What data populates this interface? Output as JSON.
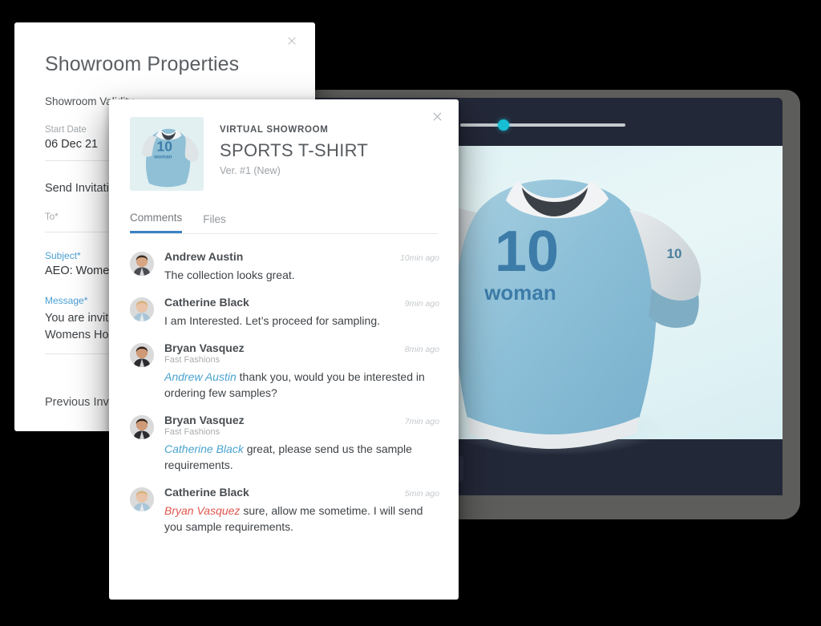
{
  "device": {
    "name": "tablet-device",
    "slider": {
      "name": "zoom-slider",
      "value_pct": 26
    },
    "action_bar": {
      "like_icon": "heart-icon",
      "comment_icon": "chat-bubble-icon",
      "next_icon": "chevron-right-icon"
    },
    "product_preview": {
      "number_print": "10",
      "word_print": "woman",
      "sleeve_print": "10"
    }
  },
  "properties_panel": {
    "close_icon": "close-icon",
    "title": "Showroom Properties",
    "section_validity": "Showroom Validity",
    "start_date": {
      "label": "Start Date",
      "value": "06 Dec 21"
    },
    "send_invitation": "Send Invitation",
    "to": {
      "label": "To*",
      "value": ""
    },
    "subject": {
      "label": "Subject*",
      "value": "AEO: Womens"
    },
    "message": {
      "label": "Message*",
      "line1": "You are invite",
      "line2": "Womens Holi"
    },
    "previous_invitations": "Previous Invit"
  },
  "comments_modal": {
    "close_icon": "close-icon",
    "thumbnail_alt": "sports-tshirt-thumbnail",
    "eyebrow": "VIRTUAL SHOWROOM",
    "product_name": "SPORTS T-SHIRT",
    "version": "Ver. #1 (New)",
    "tabs": [
      {
        "label": "Comments",
        "active": true
      },
      {
        "label": "Files",
        "active": false
      }
    ],
    "comments": [
      {
        "author": "Andrew Austin",
        "org": "",
        "time": "10min ago",
        "mention": "",
        "mention_color": "",
        "text": "The collection looks great."
      },
      {
        "author": "Catherine Black",
        "org": "",
        "time": "9min ago",
        "mention": "",
        "mention_color": "",
        "text": "I am Interested. Let’s proceed for sampling."
      },
      {
        "author": "Bryan Vasquez",
        "org": "Fast Fashions",
        "time": "8min ago",
        "mention": "Andrew Austin",
        "mention_color": "blue",
        "text": " thank you, would you be interested in ordering few samples?"
      },
      {
        "author": "Bryan Vasquez",
        "org": "Fast Fashions",
        "time": "7min ago",
        "mention": "Catherine Black",
        "mention_color": "blue",
        "text": " great, please send us the sample requirements."
      },
      {
        "author": "Catherine Black",
        "org": "",
        "time": "5min ago",
        "mention": "Bryan Vasquez",
        "mention_color": "red",
        "text": " sure, allow me sometime. I will send you sample requirements."
      }
    ]
  },
  "colors": {
    "background": "#000000",
    "device_frame": "#5d5d5b",
    "device_screen": "#232838",
    "accent_cyan": "#17bed4",
    "accent_blue": "#3b82c4",
    "mention_blue": "#4aa3cf",
    "mention_red": "#e0564e"
  }
}
